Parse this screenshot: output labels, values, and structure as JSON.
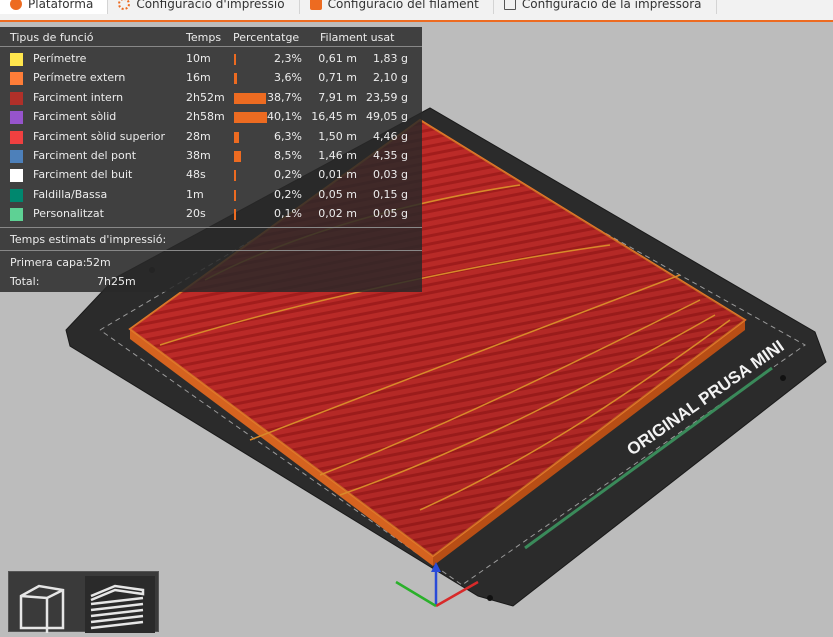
{
  "tabs": [
    {
      "label": "Plataforma",
      "icon": "plater-icon",
      "active": true
    },
    {
      "label": "Configuració d'impressió",
      "icon": "gear-icon",
      "active": false
    },
    {
      "label": "Configuració del filament",
      "icon": "spool-icon",
      "active": false
    },
    {
      "label": "Configuració de la impressora",
      "icon": "printer-icon",
      "active": false
    }
  ],
  "legend": {
    "headers": {
      "feature_type": "Tipus de funció",
      "time": "Temps",
      "percentage": "Percentatge",
      "filament_used": "Filament usat"
    },
    "rows": [
      {
        "name": "Perímetre",
        "color": "#ffe64d",
        "time": "10m",
        "percent": 2.3,
        "percent_label": "2,3%",
        "length": "0,61 m",
        "weight": "1,83 g"
      },
      {
        "name": "Perímetre extern",
        "color": "#ff7d38",
        "time": "16m",
        "percent": 3.6,
        "percent_label": "3,6%",
        "length": "0,71 m",
        "weight": "2,10 g"
      },
      {
        "name": "Farciment intern",
        "color": "#b03029",
        "time": "2h52m",
        "percent": 38.7,
        "percent_label": "38,7%",
        "length": "7,91 m",
        "weight": "23,59 g"
      },
      {
        "name": "Farciment sòlid",
        "color": "#9654cc",
        "time": "2h58m",
        "percent": 40.1,
        "percent_label": "40,1%",
        "length": "16,45 m",
        "weight": "49,05 g"
      },
      {
        "name": "Farciment sòlid superior",
        "color": "#f04040",
        "time": "28m",
        "percent": 6.3,
        "percent_label": "6,3%",
        "length": "1,50 m",
        "weight": "4,46 g"
      },
      {
        "name": "Farciment del pont",
        "color": "#4d80ba",
        "time": "38m",
        "percent": 8.5,
        "percent_label": "8,5%",
        "length": "1,46 m",
        "weight": "4,35 g"
      },
      {
        "name": "Farciment del buit",
        "color": "#ffffff",
        "time": "48s",
        "percent": 0.2,
        "percent_label": "0,2%",
        "length": "0,01 m",
        "weight": "0,03 g"
      },
      {
        "name": "Faldilla/Bassa",
        "color": "#00876e",
        "time": "1m",
        "percent": 0.2,
        "percent_label": "0,2%",
        "length": "0,05 m",
        "weight": "0,15 g"
      },
      {
        "name": "Personalitzat",
        "color": "#5ed194",
        "time": "20s",
        "percent": 0.1,
        "percent_label": "0,1%",
        "length": "0,02 m",
        "weight": "0,05 g"
      }
    ],
    "estimated_title": "Temps estimats d'impressió:",
    "first_layer_label": "Primera capa:",
    "first_layer_value": "52m",
    "total_label": "Total:",
    "total_value": "7h25m"
  },
  "bed": {
    "label": "ORIGINAL PRUSA MINI",
    "model_color": "#cf2f2c",
    "edge_color": "#e3782a"
  },
  "view_buttons": [
    {
      "name": "3D view",
      "icon": "cube-3d-icon",
      "selected": false
    },
    {
      "name": "Preview",
      "icon": "layers-preview-icon",
      "selected": true
    }
  ],
  "colors": {
    "accent": "#ed6b21",
    "legend_bg": "#282828"
  }
}
